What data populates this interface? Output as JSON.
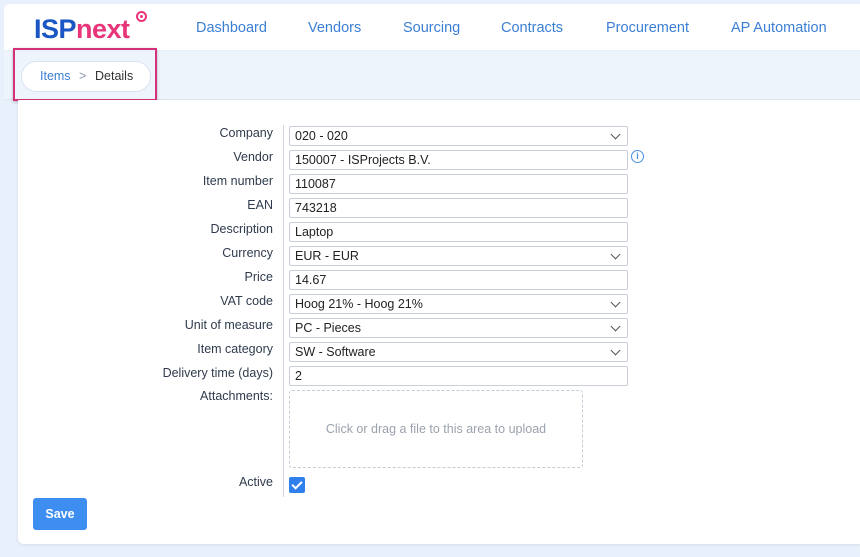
{
  "app": {
    "logo_part1": "ISP",
    "logo_part2": "next",
    "brand_blue": "#1a56c4",
    "brand_pink": "#e8357a"
  },
  "nav": {
    "items": [
      "Dashboard",
      "Vendors",
      "Sourcing",
      "Contracts",
      "Procurement",
      "AP Automation"
    ]
  },
  "breadcrumb": {
    "root": "Items",
    "separator": ">",
    "current": "Details"
  },
  "form": {
    "company": {
      "label": "Company",
      "value": "020 - 020"
    },
    "vendor": {
      "label": "Vendor",
      "value": "150007 - ISProjects B.V.",
      "icon": "info-icon"
    },
    "item_number": {
      "label": "Item number",
      "value": "110087"
    },
    "ean": {
      "label": "EAN",
      "value": "743218"
    },
    "description": {
      "label": "Description",
      "value": "Laptop"
    },
    "currency": {
      "label": "Currency",
      "value": "EUR - EUR"
    },
    "price": {
      "label": "Price",
      "value": "14.67"
    },
    "vat_code": {
      "label": "VAT code",
      "value": "Hoog 21% - Hoog 21%"
    },
    "unit_of_measure": {
      "label": "Unit of measure",
      "value": "PC - Pieces"
    },
    "item_category": {
      "label": "Item category",
      "value": "SW - Software"
    },
    "delivery_time": {
      "label": "Delivery time (days)",
      "value": "2"
    },
    "attachments": {
      "label": "Attachments:",
      "dropzone_text": "Click or drag a file to this area to upload"
    },
    "active": {
      "label": "Active",
      "checked": true
    }
  },
  "actions": {
    "save_label": "Save",
    "accent": "#3d8ef0"
  }
}
